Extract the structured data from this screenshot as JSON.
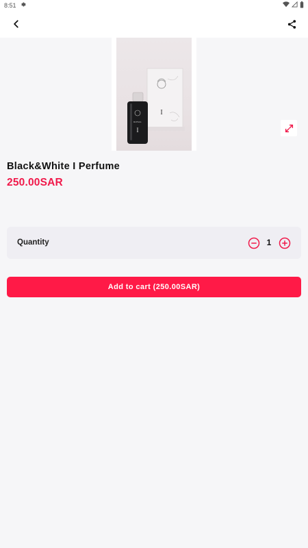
{
  "status_bar": {
    "time": "8:51",
    "icons": [
      "settings-icon",
      "wifi-icon",
      "signal-icon",
      "battery-icon"
    ]
  },
  "top_bar": {
    "back_icon": "chevron-left-icon",
    "share_icon": "share-icon"
  },
  "product": {
    "name": "Black&White I Perfume",
    "price": "250.00SAR",
    "image_alt": "Perfume bottle and box",
    "expand_icon": "expand-icon",
    "bottle_label": "ROYAL",
    "bottle_numeral": "I",
    "box_numeral": "I"
  },
  "quantity": {
    "label": "Quantity",
    "value": "1",
    "minus_icon": "minus-circle-icon",
    "plus_icon": "plus-circle-icon"
  },
  "cart": {
    "button_label": "Add to cart (250.00SAR)"
  },
  "colors": {
    "accent": "#f0194a",
    "button": "#ff1a47",
    "background": "#f6f6f8",
    "card": "#efeef3"
  }
}
